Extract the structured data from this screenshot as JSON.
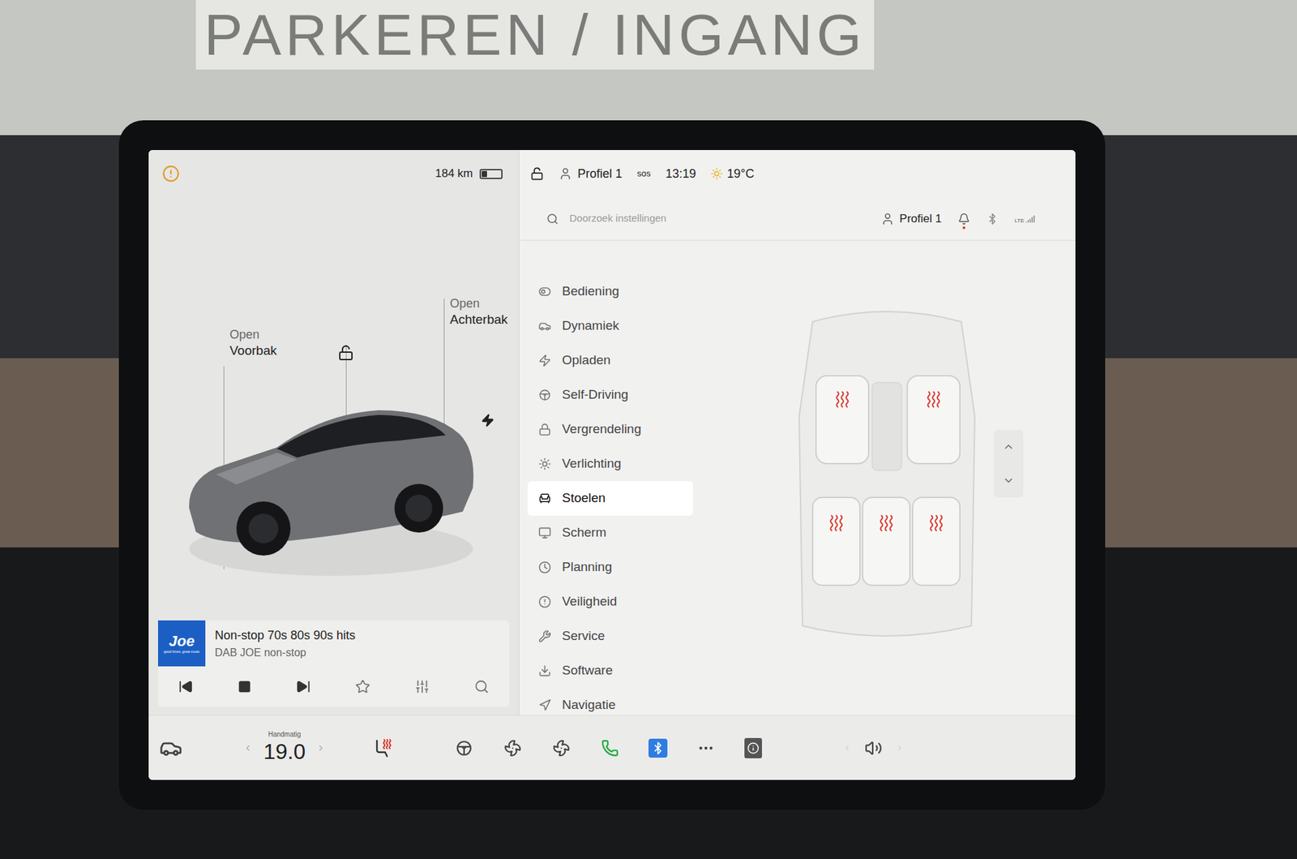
{
  "sign": "PARKEREN / INGANG",
  "status_bar": {
    "range": "184 km",
    "battery_level": 0.3,
    "locked": false,
    "profile": "Profiel 1",
    "sos": "sos",
    "time": "13:19",
    "temperature": "19°C"
  },
  "car": {
    "labels": [
      {
        "title": "Open",
        "subtitle": "Voorbak"
      },
      {
        "title": "Open",
        "subtitle": "Achterbak"
      }
    ],
    "locked": false,
    "charging": true
  },
  "media": {
    "logo": "Joe",
    "logo_tagline": "good times, great music",
    "title": "Non-stop 70s 80s 90s hits",
    "source": "DAB JOE non-stop",
    "playing": true
  },
  "settings": {
    "search_placeholder": "Doorzoek instellingen",
    "profile": "Profiel 1",
    "network": "LTE",
    "items": [
      {
        "label": "Bediening",
        "selected": false
      },
      {
        "label": "Dynamiek",
        "selected": false
      },
      {
        "label": "Opladen",
        "selected": false
      },
      {
        "label": "Self-Driving",
        "selected": false
      },
      {
        "label": "Vergrendeling",
        "selected": false
      },
      {
        "label": "Verlichting",
        "selected": false
      },
      {
        "label": "Stoelen",
        "selected": true
      },
      {
        "label": "Scherm",
        "selected": false
      },
      {
        "label": "Planning",
        "selected": false
      },
      {
        "label": "Veiligheid",
        "selected": false
      },
      {
        "label": "Service",
        "selected": false
      },
      {
        "label": "Software",
        "selected": false
      },
      {
        "label": "Navigatie",
        "selected": false
      }
    ]
  },
  "seats": {
    "front": [
      {
        "heat_level": 3
      },
      {
        "heat_level": 3
      }
    ],
    "rear": [
      {
        "heat_level": 3
      },
      {
        "heat_level": 3
      },
      {
        "heat_level": 3
      }
    ]
  },
  "dock": {
    "climate_mode": "Handmatig",
    "temperature": "19.0",
    "seat_heater_on": true
  }
}
